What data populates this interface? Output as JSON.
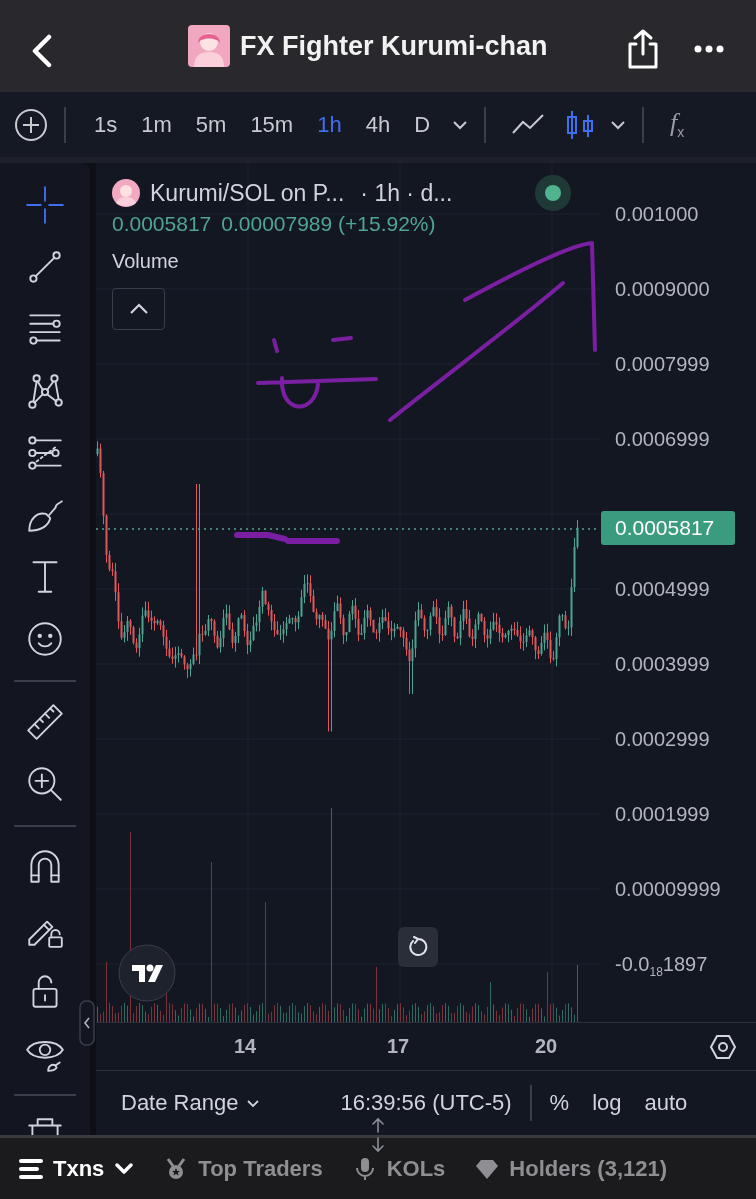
{
  "header": {
    "title": "FX Fighter Kurumi-chan"
  },
  "toolbar": {
    "intervals": [
      {
        "label": "1s",
        "selected": false
      },
      {
        "label": "1m",
        "selected": false
      },
      {
        "label": "5m",
        "selected": false
      },
      {
        "label": "15m",
        "selected": false
      },
      {
        "label": "1h",
        "selected": true
      },
      {
        "label": "4h",
        "selected": false
      },
      {
        "label": "D",
        "selected": false
      }
    ],
    "chart_types": [
      {
        "kind": "line",
        "selected": false
      },
      {
        "kind": "candles",
        "selected": true
      }
    ],
    "indicators": "*f*$_{x}$"
  },
  "sidebar": {
    "groups": [
      {
        "tools": [
          {
            "kind": "crosshair",
            "selected": true
          },
          {
            "kind": "trend-line",
            "selected": false
          },
          {
            "kind": "horizontal-lines",
            "selected": false
          },
          {
            "kind": "pattern",
            "selected": false
          },
          {
            "kind": "fib",
            "selected": false
          },
          {
            "kind": "brush",
            "selected": false
          },
          {
            "kind": "text",
            "selected": false
          },
          {
            "kind": "emoji",
            "selected": false
          }
        ]
      },
      {
        "tools": [
          {
            "kind": "ruler",
            "selected": false
          },
          {
            "kind": "zoom",
            "selected": false
          }
        ]
      },
      {
        "tools": [
          {
            "kind": "magnet",
            "selected": false
          },
          {
            "kind": "lock-drawing",
            "selected": false
          },
          {
            "kind": "lock",
            "selected": false
          },
          {
            "kind": "eye",
            "selected": false
          }
        ]
      },
      {
        "tools": [
          {
            "kind": "trash",
            "selected": false
          }
        ]
      }
    ]
  },
  "chart": {
    "legend": {
      "symbol": "Kurumi/SOL on P...",
      "details": "· 1h · d...",
      "price": "0.0005817",
      "change": "0.00007989 (+15.92%)"
    },
    "indicator": "Volume",
    "price_axis": [
      "0.001000",
      "0.0009000",
      "0.0007999",
      "0.0006999",
      "0.0004999",
      "0.0003999",
      "0.0002999",
      "0.0001999",
      "0.00009999",
      "-0.0$_{18}$1897"
    ],
    "last_price": "0.0005817",
    "time_axis": [
      "14",
      "17",
      "20"
    ]
  },
  "footer": {
    "date_range": "Date Range",
    "time": "16:39:56 (UTC-5)",
    "scale_options": [
      "%",
      "log",
      "auto"
    ]
  },
  "tabs": [
    {
      "kind": "txns",
      "label": "Txns",
      "selected": true
    },
    {
      "kind": "medal",
      "label": "Top Traders",
      "selected": false
    },
    {
      "kind": "mic",
      "label": "KOLs",
      "selected": false
    },
    {
      "kind": "diamond",
      "label": "Holders (3,121)",
      "selected": false
    }
  ]
}
